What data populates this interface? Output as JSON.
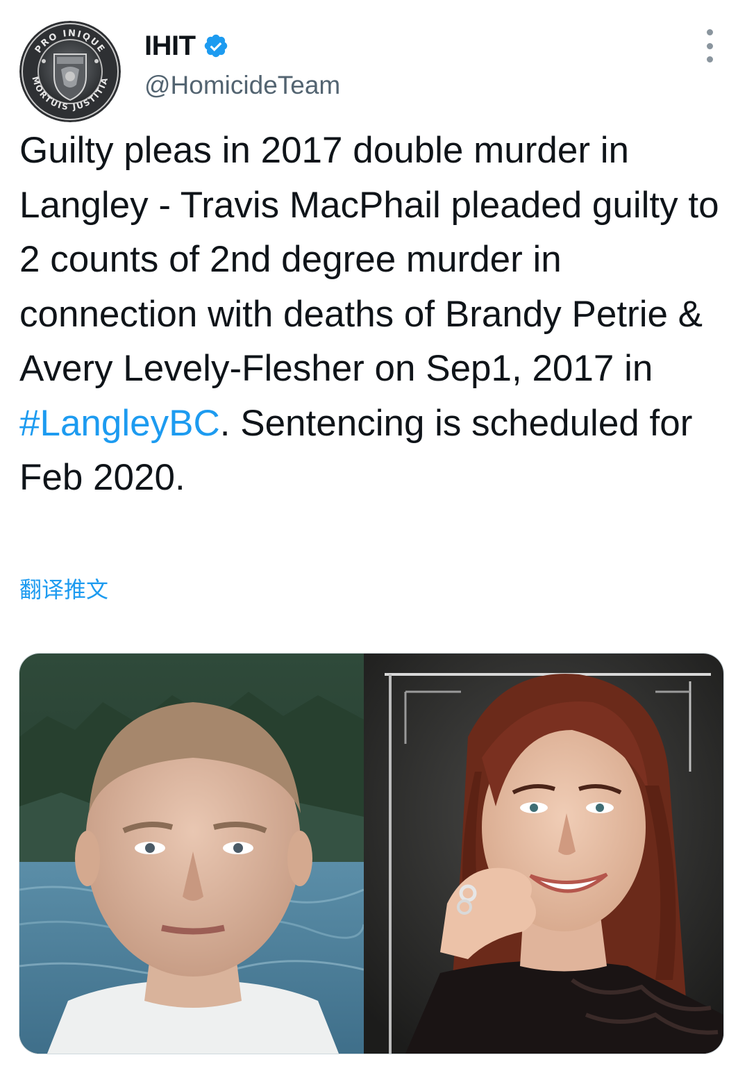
{
  "tweet": {
    "author": {
      "display_name": "IHIT",
      "handle": "@HomicideTeam",
      "verified": true,
      "avatar_icon": "ihit-badge-logo",
      "avatar_text": {
        "top": "PRO INIQUE",
        "bottom": "MORTUIS JUSTITIA"
      }
    },
    "more_icon": "more-vertical-icon",
    "text": {
      "before_hashtag": "Guilty pleas in 2017 double murder in Langley - Travis MacPhail pleaded guilty to 2 counts of 2nd degree murder in connection with deaths of Brandy Petrie & Avery Levely-Flesher on Sep1, 2017 in ",
      "hashtag": "#LangleyBC",
      "after_hashtag": ". Sentencing is scheduled for Feb 2020."
    },
    "translate_label": "翻译推文",
    "media": [
      {
        "icon": "photo-man-short-hair"
      },
      {
        "icon": "photo-woman-long-hair"
      }
    ],
    "colors": {
      "link": "#1d9bf0",
      "text": "#0f1419",
      "secondary": "#536471"
    }
  }
}
